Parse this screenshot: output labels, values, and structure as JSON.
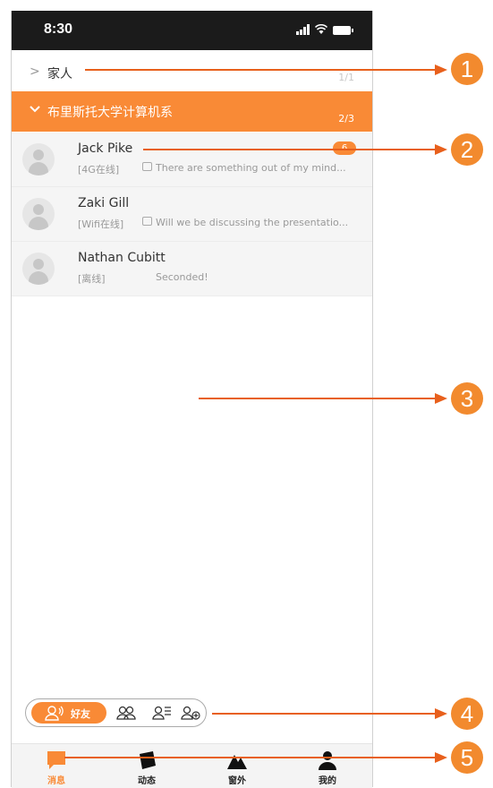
{
  "status_bar": {
    "time": "8:30"
  },
  "groups": [
    {
      "name": "家人",
      "count": "1/1",
      "expanded": false
    },
    {
      "name": "布里斯托大学计算机系",
      "count": "2/3",
      "expanded": true
    }
  ],
  "contacts": [
    {
      "name": "Jack Pike",
      "status": "[4G在线]",
      "has_image_icon": true,
      "message": "There are something out of my mind...",
      "badge": "6"
    },
    {
      "name": "Zaki Gill",
      "status": "[Wifi在线]",
      "has_image_icon": true,
      "message": "Will we be discussing the presentatio...",
      "badge": ""
    },
    {
      "name": "Nathan Cubitt",
      "status": "[离线]",
      "has_image_icon": false,
      "message": "Seconded!",
      "badge": ""
    }
  ],
  "segment": {
    "active_label": "好友",
    "icons": [
      "friends-active-icon",
      "group-icon",
      "contact-list-icon",
      "add-friend-icon"
    ]
  },
  "tabs": [
    {
      "label": "消息",
      "icon": "message-icon",
      "active": true
    },
    {
      "label": "动态",
      "icon": "moments-icon",
      "active": false
    },
    {
      "label": "窗外",
      "icon": "mountain-icon",
      "active": false
    },
    {
      "label": "我的",
      "icon": "profile-icon",
      "active": false
    }
  ],
  "callouts": [
    "1",
    "2",
    "3",
    "4",
    "5"
  ],
  "colors": {
    "accent": "#f98a36",
    "callout": "#f28a2e",
    "arrow": "#e8601c"
  }
}
